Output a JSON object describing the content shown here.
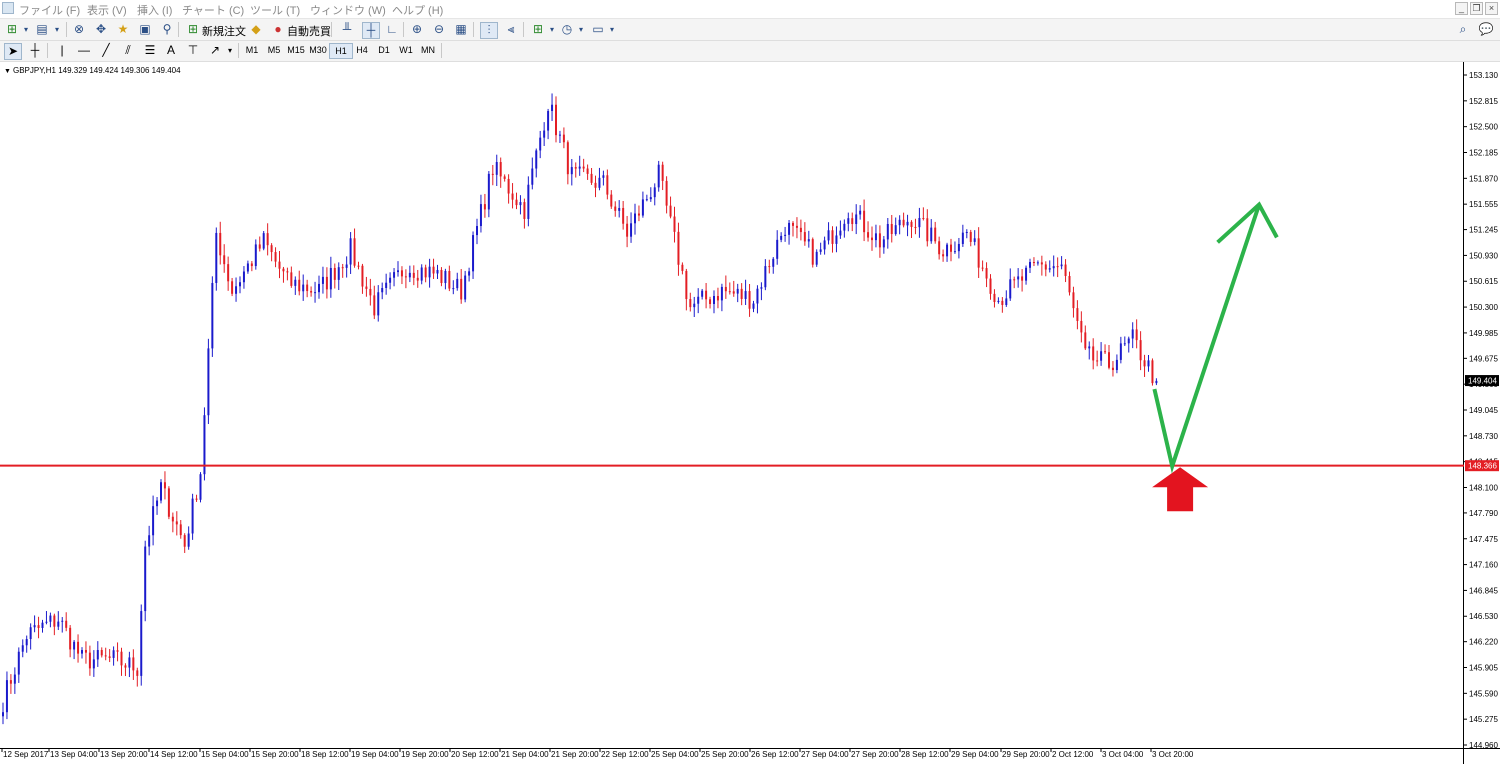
{
  "menu": [
    "ファイル (F)",
    "表示 (V)",
    "挿入 (I)",
    "チャート (C)",
    "ツール (T)",
    "ウィンドウ (W)",
    "ヘルプ (H)"
  ],
  "toolbar": {
    "new_order_label": "新規注文",
    "auto_trade_label": "自動売買",
    "timeframes": [
      "M1",
      "M5",
      "M15",
      "M30",
      "H1",
      "H4",
      "D1",
      "W1",
      "MN"
    ],
    "text_tool": "A",
    "icons": [
      "new-chart-icon",
      "profiles-icon",
      "market-watch-icon",
      "navigator-icon",
      "favorites-icon",
      "terminal-icon",
      "strategy-tester-icon",
      "bar-chart-icon",
      "candlestick-icon",
      "line-chart-icon",
      "zoom-in-icon",
      "zoom-out-icon",
      "tile-windows-icon",
      "autoscroll-icon",
      "chart-shift-icon",
      "indicators-icon",
      "periods-icon",
      "templates-icon",
      "search-icon",
      "chat-icon"
    ]
  },
  "chart_header": {
    "symbol_info": "GBPJPY,H1  149.329 149.424 149.306 149.404"
  },
  "chart_data": {
    "type": "candlestick",
    "symbol": "GBPJPY",
    "timeframe": "H1",
    "ylim": [
      144.96,
      153.3
    ],
    "y_ticks": [
      "153.130",
      "152.815",
      "152.500",
      "152.185",
      "151.870",
      "151.555",
      "151.245",
      "150.930",
      "150.615",
      "150.300",
      "149.985",
      "149.675",
      "149.360",
      "149.045",
      "148.730",
      "148.415",
      "148.100",
      "147.790",
      "147.475",
      "147.160",
      "146.845",
      "146.530",
      "146.220",
      "145.905",
      "145.590",
      "145.275",
      "144.960"
    ],
    "x_ticks": [
      "12 Sep 2017",
      "13 Sep 04:00",
      "13 Sep 20:00",
      "14 Sep 12:00",
      "15 Sep 04:00",
      "15 Sep 20:00",
      "18 Sep 12:00",
      "19 Sep 04:00",
      "19 Sep 20:00",
      "20 Sep 12:00",
      "21 Sep 04:00",
      "21 Sep 20:00",
      "22 Sep 12:00",
      "25 Sep 04:00",
      "25 Sep 20:00",
      "26 Sep 12:00",
      "27 Sep 04:00",
      "27 Sep 20:00",
      "28 Sep 12:00",
      "29 Sep 04:00",
      "29 Sep 20:00",
      "2 Oct 12:00",
      "3 Oct 04:00",
      "3 Oct 20:00"
    ],
    "current_price": "149.404",
    "horizontal_line": {
      "value": 148.366,
      "label": "148.366",
      "color": "#e31e24"
    },
    "bull_color": "#1a1acc",
    "bear_color": "#e31e24",
    "path_waypoints": [
      [
        0,
        145.5
      ],
      [
        6,
        146.3
      ],
      [
        14,
        146.5
      ],
      [
        20,
        146.0
      ],
      [
        28,
        146.0
      ],
      [
        34,
        145.9
      ],
      [
        36,
        147.4
      ],
      [
        40,
        148.1
      ],
      [
        46,
        147.4
      ],
      [
        50,
        148.3
      ],
      [
        54,
        151.2
      ],
      [
        58,
        150.5
      ],
      [
        66,
        151.1
      ],
      [
        72,
        150.6
      ],
      [
        80,
        150.5
      ],
      [
        88,
        151.0
      ],
      [
        94,
        150.3
      ],
      [
        102,
        150.8
      ],
      [
        110,
        150.7
      ],
      [
        116,
        150.5
      ],
      [
        124,
        152.0
      ],
      [
        132,
        151.5
      ],
      [
        138,
        152.8
      ],
      [
        144,
        151.9
      ],
      [
        152,
        151.8
      ],
      [
        158,
        151.2
      ],
      [
        166,
        151.9
      ],
      [
        174,
        150.3
      ],
      [
        182,
        150.5
      ],
      [
        190,
        150.4
      ],
      [
        198,
        151.3
      ],
      [
        206,
        150.9
      ],
      [
        214,
        151.5
      ],
      [
        222,
        151.1
      ],
      [
        230,
        151.4
      ],
      [
        238,
        151.0
      ],
      [
        244,
        151.2
      ],
      [
        252,
        150.4
      ],
      [
        262,
        150.8
      ],
      [
        268,
        150.8
      ],
      [
        274,
        149.7
      ],
      [
        280,
        149.6
      ],
      [
        286,
        149.9
      ],
      [
        292,
        149.4
      ]
    ],
    "projection": {
      "color": "#2cb34a",
      "points": [
        [
          291.5,
          149.3
        ],
        [
          296,
          148.36
        ],
        [
          318,
          151.55
        ]
      ],
      "arrowhead": [
        [
          307.5,
          151.09
        ],
        [
          318,
          151.55
        ],
        [
          322.5,
          151.15
        ]
      ]
    },
    "arrow_marker": {
      "color": "#e3141f",
      "position": 298,
      "value": 148.2
    }
  }
}
